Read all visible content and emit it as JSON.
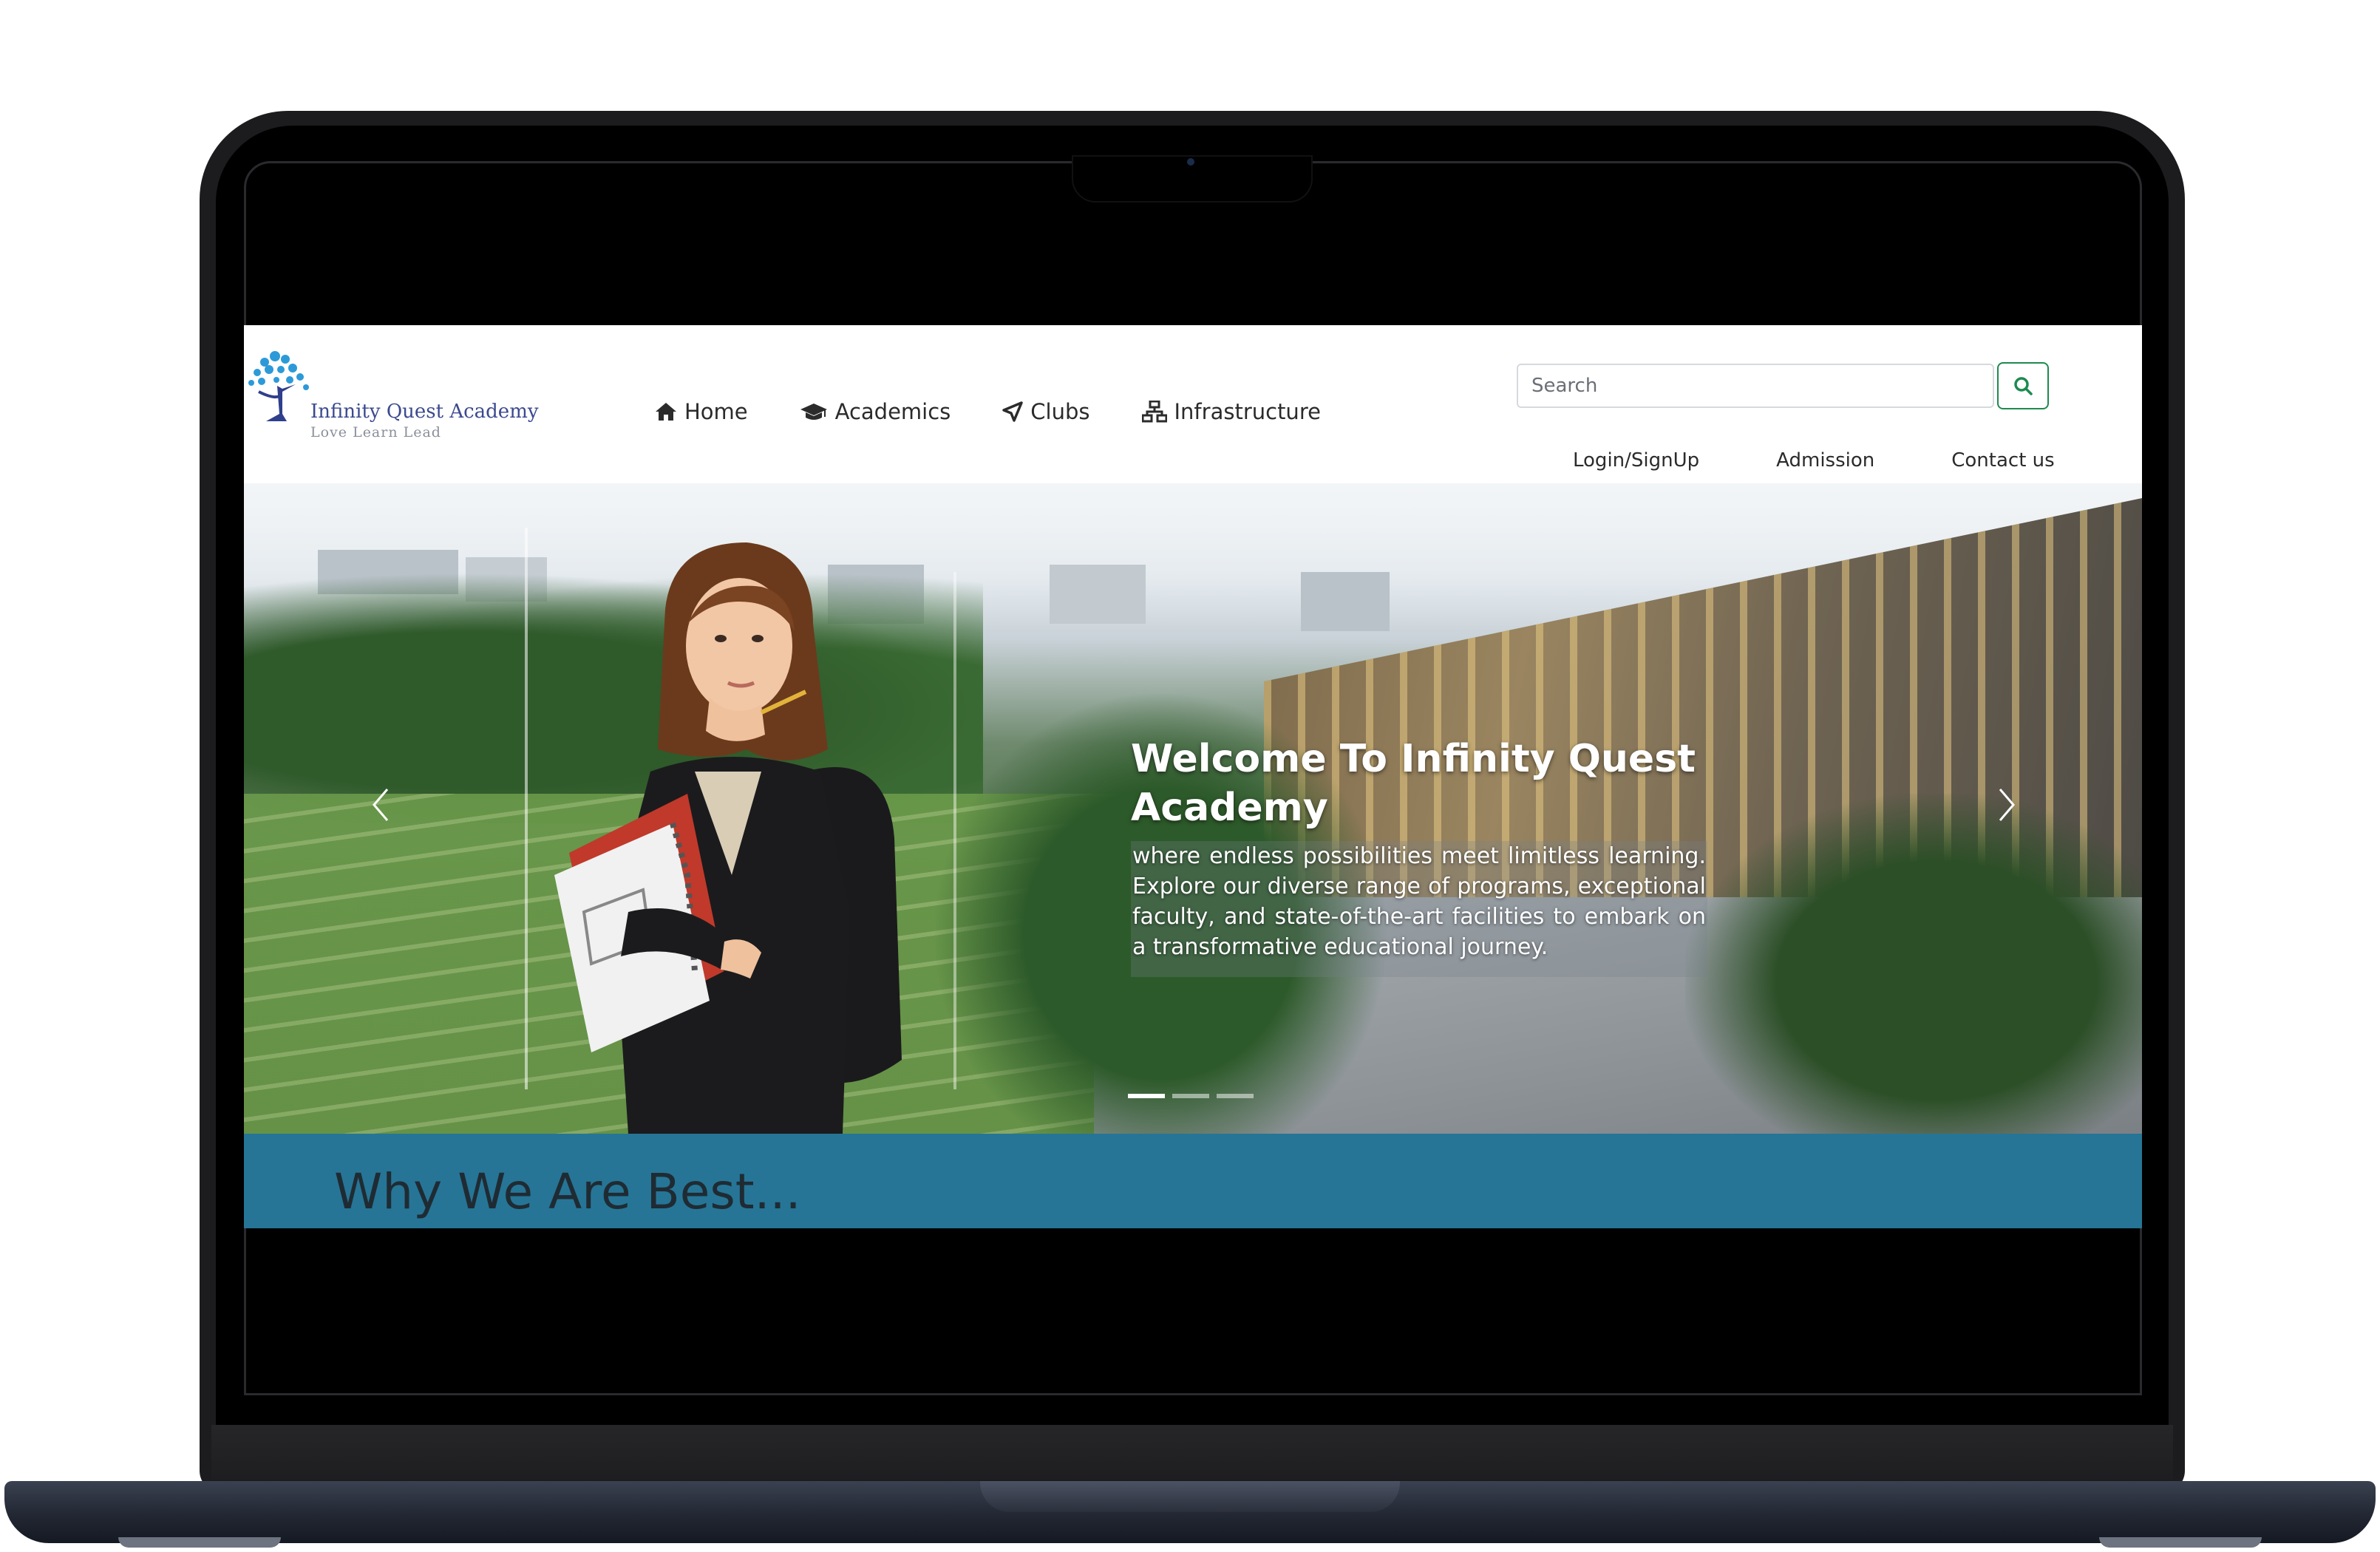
{
  "site": {
    "logo_name": "Infinity Quest Academy",
    "logo_tagline": "Love  Learn  Lead"
  },
  "nav": {
    "items": [
      {
        "label": "Home",
        "icon": "home-icon"
      },
      {
        "label": "Academics",
        "icon": "graduation-cap-icon"
      },
      {
        "label": "Clubs",
        "icon": "location-arrow-icon"
      },
      {
        "label": "Infrastructure",
        "icon": "sitemap-icon"
      }
    ]
  },
  "search": {
    "placeholder": "Search",
    "button_icon": "search-icon"
  },
  "subnav": {
    "login": "Login/SignUp",
    "admission": "Admission",
    "contact": "Contact us"
  },
  "hero": {
    "title": "Welcome To Infinity Quest Academy",
    "text": "where endless possibilities meet limitless learning. Explore our diverse range of programs, exceptional faculty, and state-of-the-art facilities to embark on a transformative educational journey.",
    "slide_count": 3,
    "active_slide": 1
  },
  "why": {
    "title": "Why We Are Best..."
  },
  "colors": {
    "section_blue": "#267596",
    "search_button_green": "#1e8a4f",
    "logo_blue": "#3b4a8f",
    "logo_tree_blue": "#2d9ad8"
  }
}
